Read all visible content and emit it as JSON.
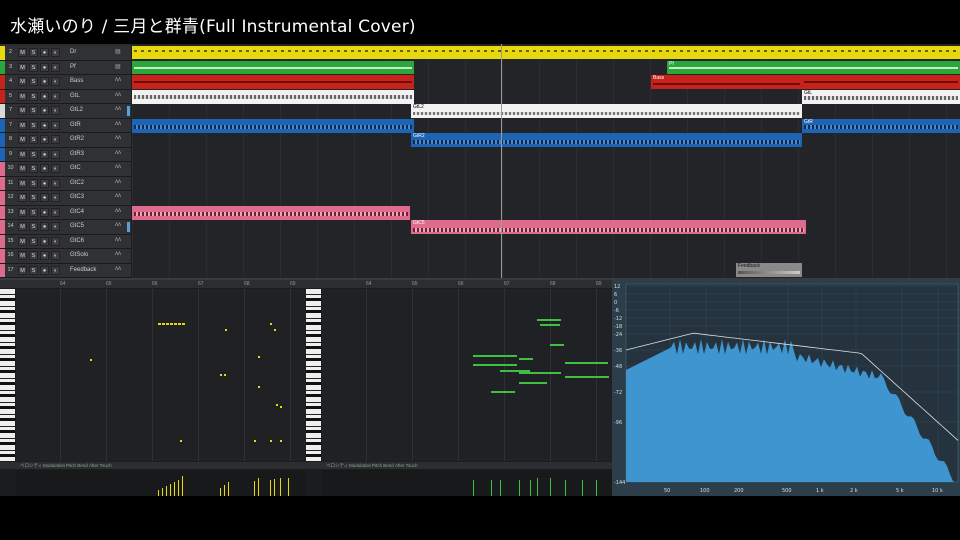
{
  "title": "水瀬いのり  /  三月と群青(Full Instrumental Cover)",
  "colors": {
    "yellow": "#e8d80e",
    "green": "#2aa63a",
    "red": "#c8231b",
    "white": "#f2f2f2",
    "blue": "#1d64b4",
    "pink": "#de6b8b"
  },
  "tracks": [
    {
      "num": "2",
      "name": "Dr",
      "mode": "▤",
      "color": "#e8d80e"
    },
    {
      "num": "3",
      "name": "Pf",
      "mode": "▤",
      "color": "#2aa63a"
    },
    {
      "num": "4",
      "name": "Bass",
      "mode": "ʌʌ",
      "color": "#c8231b"
    },
    {
      "num": "5",
      "name": "GtL",
      "mode": "ʌʌ",
      "color": "#c8231b"
    },
    {
      "num": "7",
      "name": "GtL2",
      "mode": "ʌʌ",
      "color": "#d8d8d8"
    },
    {
      "num": "7",
      "name": "GtR",
      "mode": "ʌʌ",
      "color": "#1d64b4"
    },
    {
      "num": "8",
      "name": "GtR2",
      "mode": "ʌʌ",
      "color": "#1d64b4"
    },
    {
      "num": "9",
      "name": "GtR3",
      "mode": "ʌʌ",
      "color": "#1d64b4"
    },
    {
      "num": "10",
      "name": "GtC",
      "mode": "ʌʌ",
      "color": "#de6b8b"
    },
    {
      "num": "11",
      "name": "GtC2",
      "mode": "ʌʌ",
      "color": "#de6b8b"
    },
    {
      "num": "12",
      "name": "GtC3",
      "mode": "ʌʌ",
      "color": "#de6b8b"
    },
    {
      "num": "13",
      "name": "GtC4",
      "mode": "ʌʌ",
      "color": "#de6b8b"
    },
    {
      "num": "14",
      "name": "GtC5",
      "mode": "ʌʌ",
      "color": "#de6b8b"
    },
    {
      "num": "15",
      "name": "GtC6",
      "mode": "ʌʌ",
      "color": "#de6b8b"
    },
    {
      "num": "16",
      "name": "GtSolo",
      "mode": "ʌʌ",
      "color": "#de6b8b"
    },
    {
      "num": "17",
      "name": "Feedback",
      "mode": "ʌʌ",
      "color": "#de6b8b"
    }
  ],
  "buttons": {
    "mute": "M",
    "solo": "S",
    "rec": "●",
    "monitor": "◐"
  },
  "clip_labels": {
    "pf": "Pf",
    "bass": "Bass",
    "gtl": "GtL",
    "gtl2": "GtL2",
    "gtr": "GtR",
    "gtr2": "GtR2",
    "gtc5": "GtC5",
    "feedback": "Feedback"
  },
  "editor_left": {
    "ruler": [
      "64",
      "65",
      "66",
      "67",
      "68",
      "69"
    ],
    "tabs": [
      "ベロシティ",
      "Modulation",
      "Pitch Bend",
      "After Touch"
    ]
  },
  "editor_right": {
    "ruler": [
      "64",
      "65",
      "66",
      "67",
      "68",
      "69"
    ],
    "tabs": [
      "ベロシティ",
      "Modulation",
      "Pitch Bend",
      "After Touch"
    ]
  },
  "spectrum": {
    "db_labels": [
      "12",
      "6",
      "0",
      "-6",
      "-12",
      "-18",
      "-24",
      "-36",
      "-48",
      "-72",
      "-96",
      "-144"
    ],
    "freq_labels": [
      "50",
      "100",
      "200",
      "500",
      "1 k",
      "2 k",
      "5 k",
      "10 k"
    ]
  }
}
